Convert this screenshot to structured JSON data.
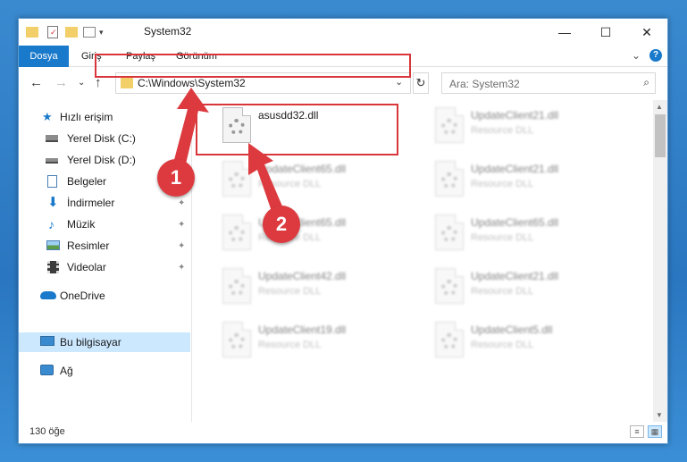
{
  "window": {
    "title": "System32",
    "minimize": "—",
    "maximize": "☐",
    "close": "✕"
  },
  "ribbon": {
    "tabs": [
      "Dosya",
      "Giriş",
      "Paylaş",
      "Görünüm"
    ],
    "collapse_glyph": "⌄",
    "help_glyph": "?"
  },
  "navigation": {
    "back": "←",
    "forward": "→",
    "recent": "⌄",
    "up": "↑",
    "address": "C:\\Windows\\System32",
    "address_dropdown": "⌄",
    "refresh": "↻",
    "search_placeholder": "Ara: System32",
    "search_icon": "⌕"
  },
  "sidebar": {
    "items": [
      {
        "label": "Hızlı erişim",
        "icon": "star-icon",
        "pinned": false
      },
      {
        "label": "Yerel Disk (C:)",
        "icon": "drive-icon",
        "pinned": false
      },
      {
        "label": "Yerel Disk (D:)",
        "icon": "drive-icon",
        "pinned": false
      },
      {
        "label": "Belgeler",
        "icon": "document-icon",
        "pinned": false
      },
      {
        "label": "İndirmeler",
        "icon": "download-icon",
        "pinned": true
      },
      {
        "label": "Müzik",
        "icon": "music-icon",
        "pinned": true
      },
      {
        "label": "Resimler",
        "icon": "pictures-icon",
        "pinned": true
      },
      {
        "label": "Videolar",
        "icon": "video-icon",
        "pinned": true
      },
      {
        "label": "OneDrive",
        "icon": "cloud-icon",
        "pinned": false
      },
      {
        "label": "Bu bilgisayar",
        "icon": "computer-icon",
        "pinned": false,
        "selected": true
      },
      {
        "label": "Ağ",
        "icon": "network-icon",
        "pinned": false
      }
    ],
    "pin_glyph": "📌"
  },
  "files": [
    {
      "name": "asusdd32.dll",
      "type": "",
      "highlighted": true
    },
    {
      "name": "UpdateClient21.dll",
      "type": "Resource DLL"
    },
    {
      "name": "UpdateClient65.dll",
      "type": "Resource DLL"
    },
    {
      "name": "UpdateClient21.dll",
      "type": "Resource DLL"
    },
    {
      "name": "UpdateClient65.dll",
      "type": "Resource DLL"
    },
    {
      "name": "UpdateClient65.dll",
      "type": "Resource DLL"
    },
    {
      "name": "UpdateClient42.dll",
      "type": "Resource DLL"
    },
    {
      "name": "UpdateClient21.dll",
      "type": "Resource DLL"
    },
    {
      "name": "UpdateClient19.dll",
      "type": "Resource DLL"
    },
    {
      "name": "UpdateClient5.dll",
      "type": "Resource DLL"
    }
  ],
  "status": {
    "count": "130 öğe"
  },
  "annotations": {
    "step1": "1",
    "step2": "2",
    "color": "#dc3a3f"
  }
}
